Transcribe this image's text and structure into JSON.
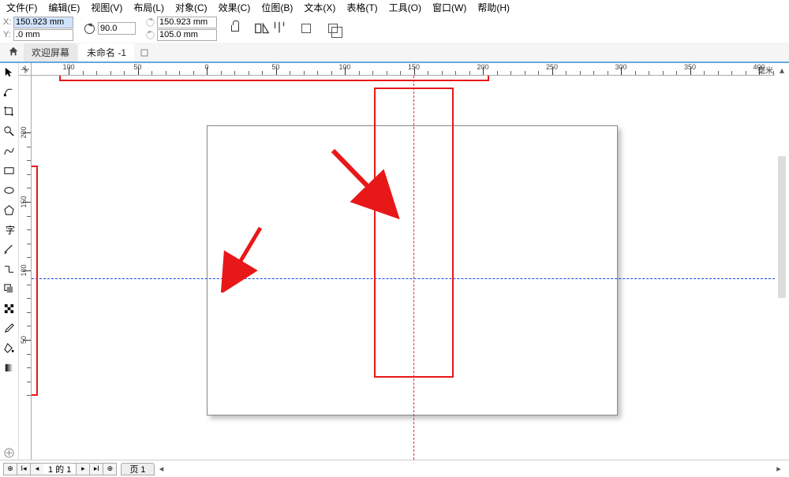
{
  "menu": {
    "file": "文件(F)",
    "edit": "编辑(E)",
    "view": "视图(V)",
    "layout": "布局(L)",
    "object": "对象(C)",
    "effects": "效果(C)",
    "bitmap": "位图(B)",
    "text": "文本(X)",
    "table": "表格(T)",
    "tools": "工具(O)",
    "window": "窗口(W)",
    "help": "帮助(H)"
  },
  "prop": {
    "x_label": "X:",
    "y_label": "Y:",
    "x_value": "150.923 mm",
    "y_value": ".0 mm",
    "rotation": "90.0",
    "w_value": "150.923 mm",
    "h_value": "105.0 mm"
  },
  "tabs": {
    "welcome": "欢迎屏幕",
    "doc": "未命名 -1"
  },
  "ruler": {
    "unit": "毫米",
    "h_labels": [
      "100",
      "50",
      "0",
      "50",
      "100",
      "150",
      "200",
      "250",
      "300",
      "350",
      "400"
    ],
    "v_labels": [
      "200",
      "150",
      "100",
      "50"
    ]
  },
  "status": {
    "page_counter": "1 的 1",
    "page_tab": "页 1"
  },
  "icons": {
    "home": "home-icon",
    "picker": "pick-tool",
    "shape": "shape-tool",
    "crop": "crop-tool",
    "zoom": "zoom-tool",
    "freehand": "freehand-tool",
    "rect": "rectangle-tool",
    "ellipse": "ellipse-tool",
    "polygon": "polygon-tool",
    "text": "text-tool",
    "pen": "pen-tool",
    "dim": "dimension-tool",
    "connector": "connector-tool",
    "shadow": "interactive-tool",
    "transparency": "transparency-tool",
    "dropper": "eyedropper-tool",
    "fill": "fill-tool",
    "interactive_fill": "interactive-fill-tool"
  }
}
